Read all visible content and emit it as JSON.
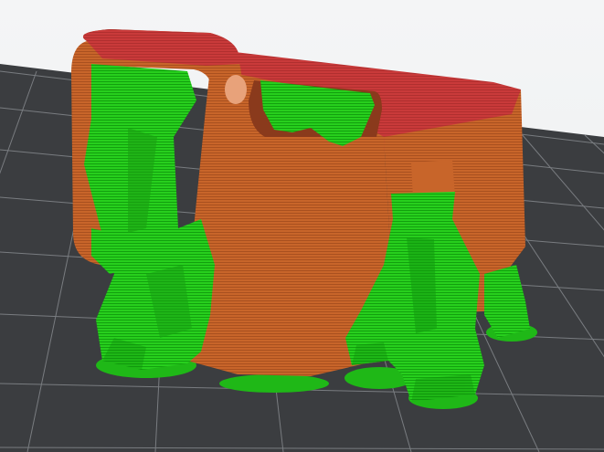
{
  "viewer": {
    "view": "slice-preview-3d",
    "colors": {
      "background": "#f2f3f4",
      "bed": "#3b3d40",
      "bed_grid": "#8e9296",
      "model_wall": "#c8652a",
      "model_wall_dark": "#a9501f",
      "model_top": "#c93a3a",
      "support": "#23c81a",
      "support_dark": "#14a010"
    },
    "objects": [
      {
        "name": "printed-part",
        "role": "model"
      },
      {
        "name": "tree-supports",
        "role": "support"
      }
    ]
  }
}
